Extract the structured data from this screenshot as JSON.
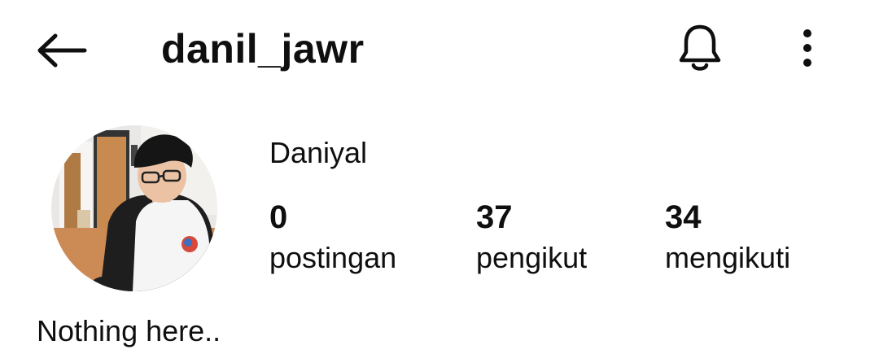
{
  "header": {
    "username": "danil_jawr",
    "back_icon": "arrow-left-icon",
    "notify_icon": "bell-icon",
    "more_icon": "more-vertical-icon"
  },
  "profile": {
    "display_name": "Daniyal",
    "bio": "Nothing here..",
    "avatar": "profile-photo"
  },
  "stats": [
    {
      "value": "0",
      "label": "postingan"
    },
    {
      "value": "37",
      "label": "pengikut"
    },
    {
      "value": "34",
      "label": "mengikuti"
    }
  ],
  "colors": {
    "text": "#0f0f0f",
    "background": "#ffffff"
  }
}
